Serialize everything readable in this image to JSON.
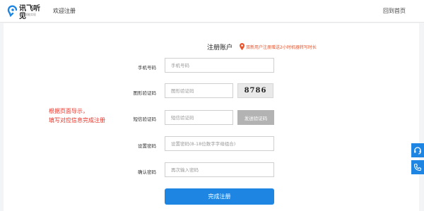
{
  "header": {
    "logo_text": "讯飞听见",
    "logo_subtext": "科学智能实现",
    "title": "欢迎注册",
    "home_link": "回到首页"
  },
  "form": {
    "title": "注册账户",
    "promo_icon": "location-pin-icon",
    "promo_text": "双新用户注册赠送2小时机器转写时长",
    "hint_lines": [
      "根据页面导示，",
      "填写对应信息完成注册"
    ],
    "fields": {
      "phone": {
        "label": "手机号码",
        "placeholder": "手机号码",
        "value": ""
      },
      "captcha": {
        "label": "图形验证码",
        "placeholder": "图形验证码",
        "value": "",
        "captcha_text": "8786"
      },
      "sms": {
        "label": "短信验证码",
        "placeholder": "短信验证码",
        "value": "",
        "button": "发送验证码"
      },
      "password": {
        "label": "设置密码",
        "placeholder": "设置密码(8-18位数字字母组合)",
        "value": ""
      },
      "confirm": {
        "label": "确认密码",
        "placeholder": "再次输入密码",
        "value": ""
      }
    },
    "submit": "完成注册"
  },
  "side_buttons": [
    {
      "icon": "headset-icon"
    },
    {
      "icon": "phone-icon"
    }
  ],
  "colors": {
    "accent": "#1f85e3",
    "promo": "#e8542b",
    "hint": "#e8362b",
    "disabled_button": "#b3b3b3"
  }
}
